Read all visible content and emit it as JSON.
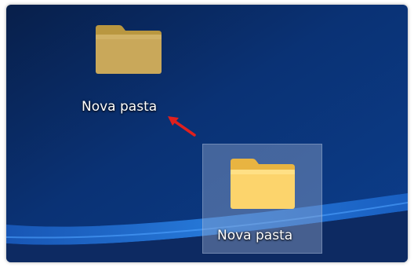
{
  "desktop": {
    "background_colors": {
      "top": "#0a2657",
      "mid": "#0a3a86",
      "bright_band": "#1f7ae0",
      "bottom": "#0d2a62"
    },
    "items": [
      {
        "label": "Nova pasta",
        "icon": "folder-icon",
        "state": "renamed-dragged-faded"
      },
      {
        "label": "Nova pasta",
        "icon": "folder-icon",
        "state": "selected"
      }
    ],
    "annotation": {
      "icon": "red-arrow-icon",
      "color": "#e0201e"
    }
  }
}
